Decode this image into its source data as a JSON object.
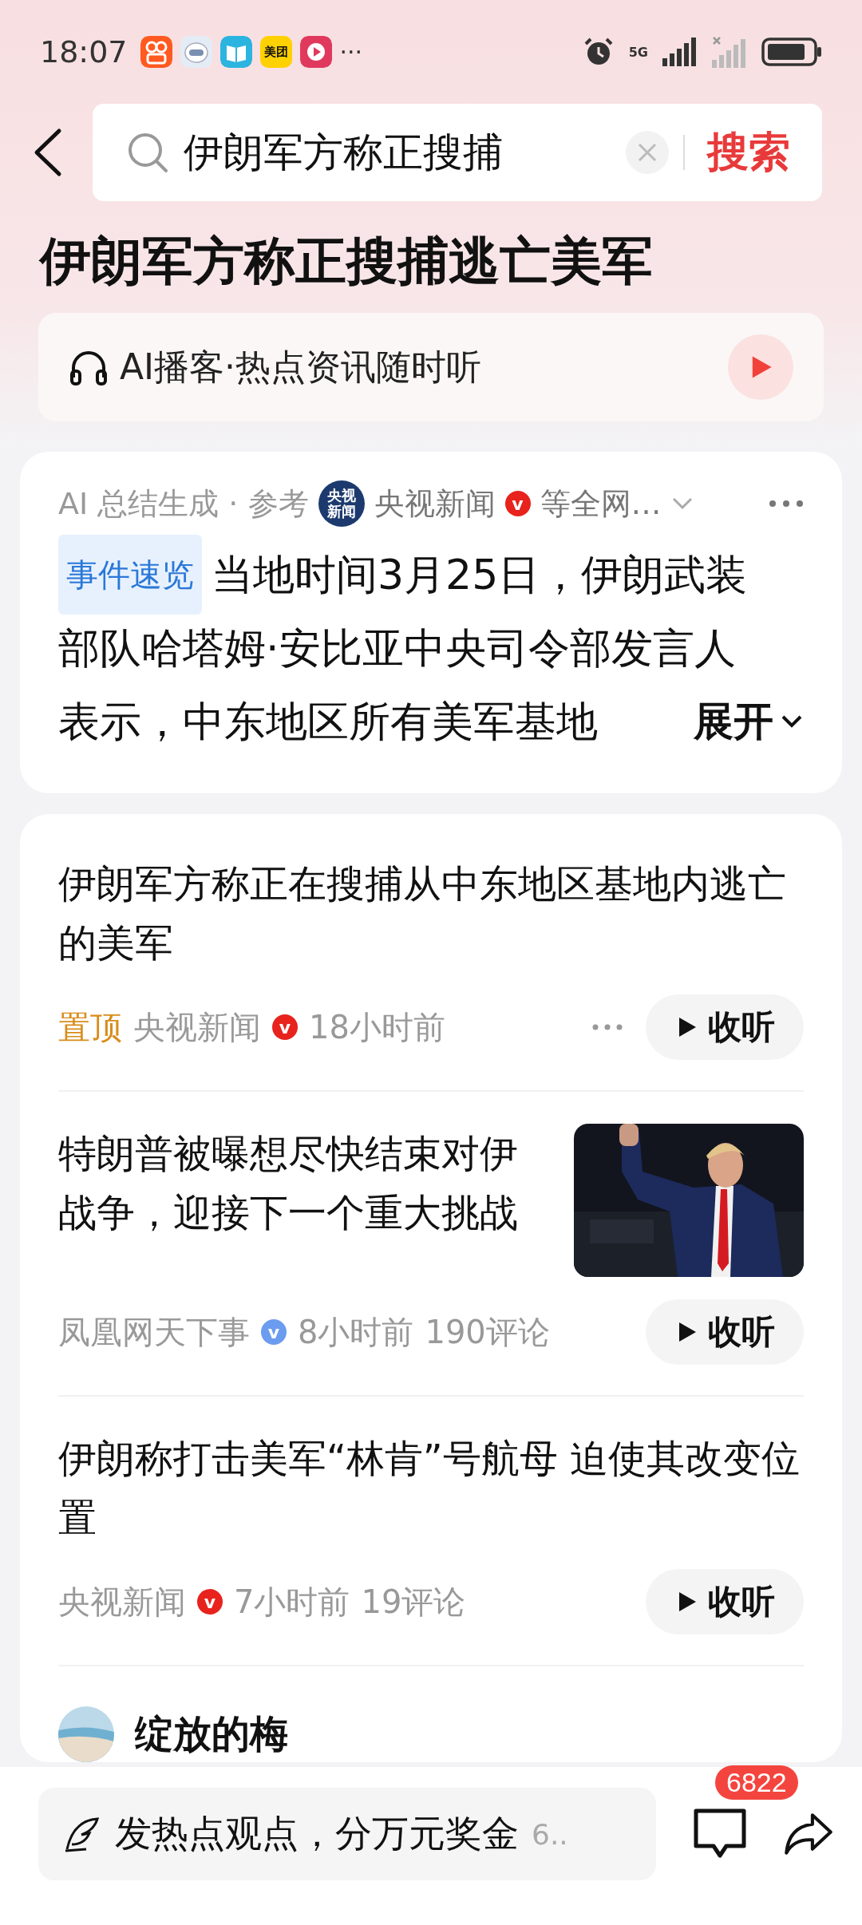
{
  "status_bar": {
    "time": "18:07",
    "app_icon_label": "美团",
    "more": "···",
    "network": "5G"
  },
  "search": {
    "value": "伊朗军方称正搜捕",
    "button": "搜索"
  },
  "title": "伊朗军方称正搜捕逃亡美军",
  "podcast": {
    "label": "AI播客·热点资讯随时听"
  },
  "summary": {
    "header": "AI 总结生成 · 参考",
    "logo_text": "央视新闻",
    "source": "央视新闻",
    "verified": {
      "label": "v",
      "color": "#e8221c"
    },
    "more_sources": "等全网…",
    "tag": "事件速览",
    "lines": [
      "当地时间3月25日，伊朗武装",
      "部队哈塔姆·安比亚中央司令部发言人",
      "表示，中东地区所有美军基地"
    ],
    "expand": "展开"
  },
  "news": [
    {
      "kind": "text",
      "title": "伊朗军方称正在搜捕从中东地区基地内逃亡的美军",
      "pinned": "置顶",
      "source": "央视新闻",
      "verified": {
        "label": "v",
        "color": "#e8221c"
      },
      "time": "18小时前",
      "listen": "收听"
    },
    {
      "title": "特朗普被曝想尽快结束对伊战争，迎接下一个重大挑战",
      "source": "凤凰网天下事",
      "verified": {
        "label": "v",
        "color": "#6b9cf0"
      },
      "time": "8小时前",
      "comments": "190评论",
      "listen": "收听"
    },
    {
      "kind": "text",
      "title": "伊朗称打击美军“林肯”号航母 迫使其改变位置",
      "source": "央视新闻",
      "verified": {
        "label": "v",
        "color": "#e8221c"
      },
      "time": "7小时前",
      "comments": "19评论",
      "listen": "收听"
    }
  ],
  "comment_user": "绽放的梅",
  "bottom_bar": {
    "placeholder": "发热点观点，分万元奖金",
    "suffix": "6..",
    "comment_count": "6822"
  }
}
